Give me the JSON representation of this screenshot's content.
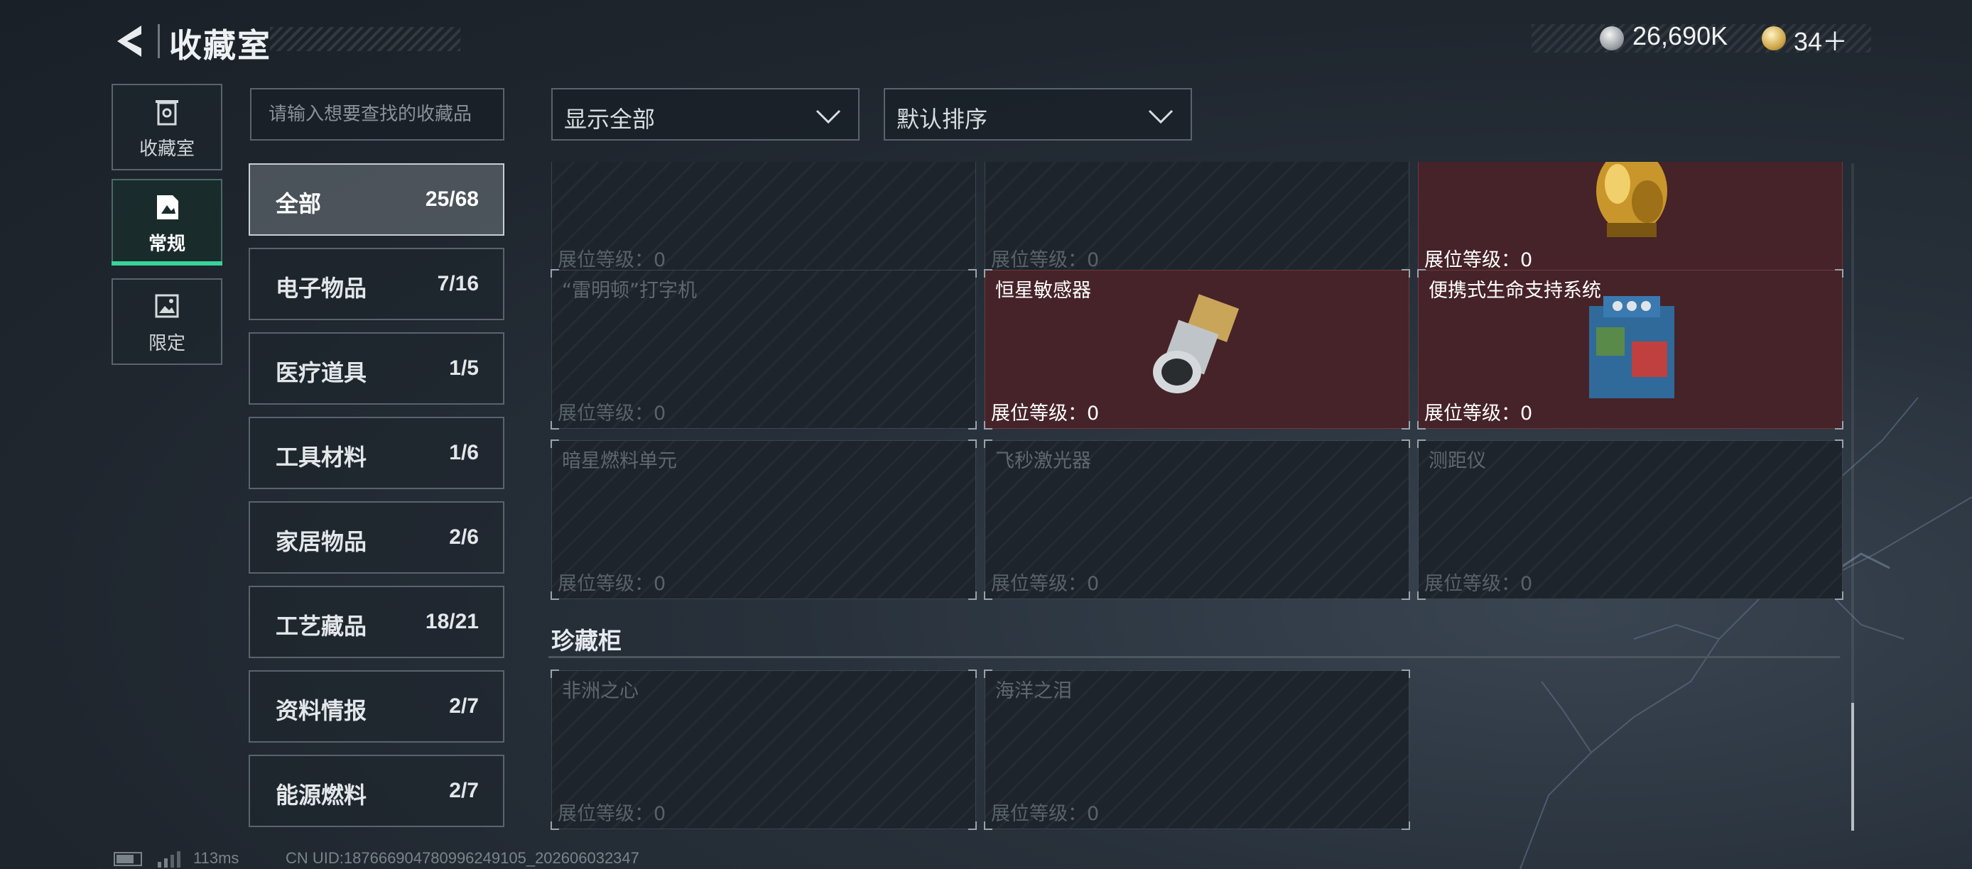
{
  "header": {
    "title": "收藏室",
    "currency_silver": "26,690K",
    "currency_gold": "34＋"
  },
  "side_tabs": [
    {
      "label": "收藏室",
      "icon": "trash-can-icon"
    },
    {
      "label": "常规",
      "icon": "document-image-icon",
      "active": true
    },
    {
      "label": "限定",
      "icon": "image-icon"
    }
  ],
  "search": {
    "placeholder": "请输入想要查找的收藏品"
  },
  "categories": [
    {
      "name": "全部",
      "count": "25/68",
      "active": true
    },
    {
      "name": "电子物品",
      "count": "7/16"
    },
    {
      "name": "医疗道具",
      "count": "1/5"
    },
    {
      "name": "工具材料",
      "count": "1/6"
    },
    {
      "name": "家居物品",
      "count": "2/6"
    },
    {
      "name": "工艺藏品",
      "count": "18/21"
    },
    {
      "name": "资料情报",
      "count": "2/7"
    },
    {
      "name": "能源燃料",
      "count": "2/7"
    }
  ],
  "filters": {
    "show": "显示全部",
    "sort": "默认排序"
  },
  "level_label": "展位等级：0",
  "cards": [
    {
      "name": "",
      "owned": false
    },
    {
      "name": "",
      "owned": false
    },
    {
      "name": "",
      "owned": true,
      "image": "golden-statue"
    },
    {
      "name": "“雷明顿”打字机",
      "owned": false
    },
    {
      "name": "恒星敏感器",
      "owned": true,
      "image": "star-sensor"
    },
    {
      "name": "便携式生命支持系统",
      "owned": true,
      "image": "life-support-system"
    },
    {
      "name": "暗星燃料单元",
      "owned": false
    },
    {
      "name": "飞秒激光器",
      "owned": false
    },
    {
      "name": "测距仪",
      "owned": false
    }
  ],
  "section": {
    "title": "珍藏柜"
  },
  "cabinet_cards": [
    {
      "name": "非洲之心",
      "owned": false
    },
    {
      "name": "海洋之泪",
      "owned": false
    }
  ],
  "footer": {
    "ping": "113ms",
    "uid": "CN UID:187666904780996249105_202606032347"
  },
  "colors": {
    "accent": "#38d39a",
    "owned_card": "#462328",
    "background": "#222a32"
  }
}
